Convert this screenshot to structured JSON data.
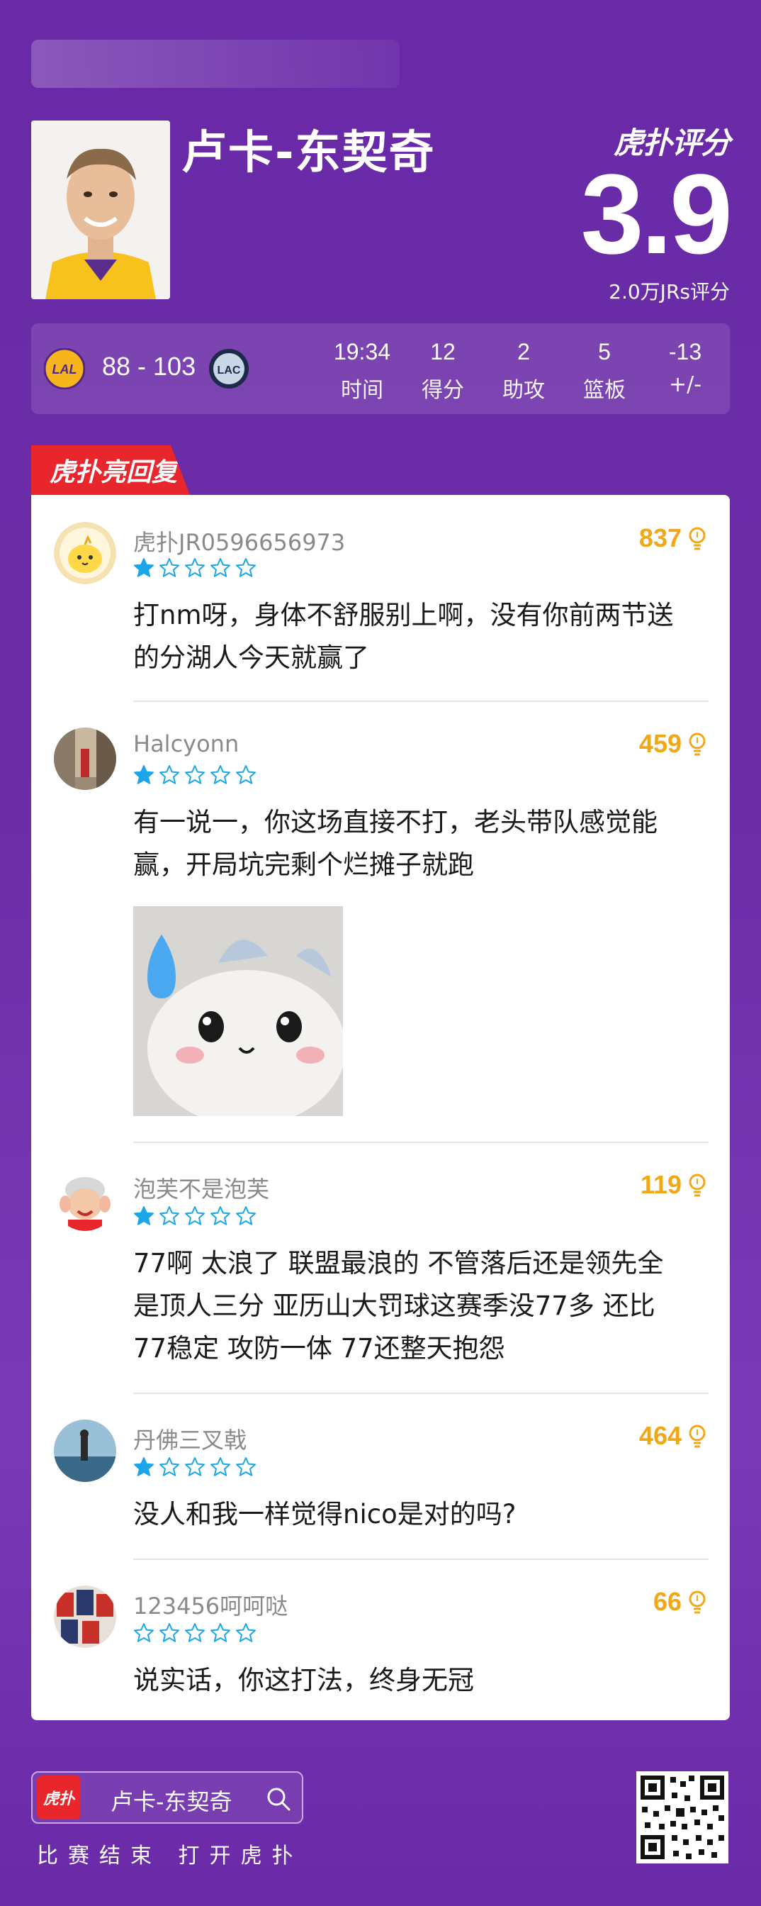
{
  "header": {
    "player_name": "卢卡-东契奇",
    "brand": "虎扑评分",
    "score": "3.9",
    "rating_count": "2.0万JRs评分"
  },
  "game": {
    "score": "88 - 103",
    "home_team_icon": "lakers-logo",
    "away_team_icon": "clippers-logo",
    "stats": [
      {
        "value": "19:34",
        "label": "时间"
      },
      {
        "value": "12",
        "label": "得分"
      },
      {
        "value": "2",
        "label": "助攻"
      },
      {
        "value": "5",
        "label": "篮板"
      },
      {
        "value": "-13",
        "label": "+/-"
      }
    ]
  },
  "section_title": "虎扑亮回复",
  "comments": [
    {
      "user": "虎扑JR0596656973",
      "likes": "837",
      "stars": 1,
      "lines": [
        "打nm呀，身体不舒服别上啊，没有你前两节送",
        "的分湖人今天就赢了"
      ]
    },
    {
      "user": "Halcyonn",
      "likes": "459",
      "stars": 1,
      "lines": [
        "有一说一，你这场直接不打，老头带队感觉能",
        "赢，开局坑完剩个烂摊子就跑"
      ]
    },
    {
      "user": "泡芙不是泡芙",
      "likes": "119",
      "stars": 1,
      "lines": [
        "77啊 太浪了 联盟最浪的 不管落后还是领先全",
        "是顶人三分 亚历山大罚球这赛季没77多 还比",
        "77稳定 攻防一体 77还整天抱怨"
      ]
    },
    {
      "user": "丹佛三叉戟",
      "likes": "464",
      "stars": 1,
      "lines": [
        "没人和我一样觉得nico是对的吗?"
      ]
    },
    {
      "user": "123456呵呵哒",
      "likes": "66",
      "stars": 0,
      "lines": [
        "说实话，你这打法，终身无冠"
      ]
    }
  ],
  "footer": {
    "app_icon_label": "虎扑",
    "search_text": "卢卡-东契奇",
    "cta": "比赛结束 打开虎扑"
  },
  "colors": {
    "background": "#6a2aa8",
    "accent_red": "#e8262c",
    "likes_gold": "#f0a818",
    "star_blue": "#1aa6e8"
  }
}
